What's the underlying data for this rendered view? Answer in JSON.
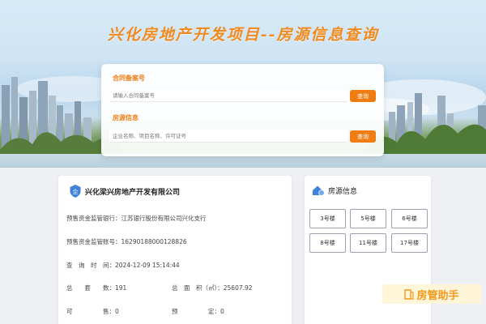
{
  "hero": {
    "title": "兴化房地产开发项目--房源信息查询"
  },
  "search": {
    "contract_label": "合同备案号",
    "contract_placeholder": "请输入合同备案号",
    "contract_button": "查询",
    "housing_label": "房源信息",
    "housing_placeholder": "企业名称、项目名称、许可证号",
    "housing_button": "查询"
  },
  "company": {
    "name": "兴化梁兴房地产开发有限公司",
    "rows": {
      "bank_label": "预售资金监管银行：",
      "bank_value": "江苏银行股份有限公司兴化支行",
      "account_label": "预售资金监管账号：",
      "account_value": "16290188000128826",
      "time_label": "查　询　时　间：",
      "time_value": "2024-12-09 15:14:44",
      "units_label": "总　　套　　数：",
      "units_value": "191",
      "area_label": "总　面　积（㎡）：",
      "area_value": "25607.92",
      "sellable_label": "可　　　　　售：",
      "sellable_value": "0",
      "reserved_label": "预　　　　　定：",
      "reserved_value": "0"
    }
  },
  "housing": {
    "title": "房源信息",
    "buildings": [
      "3号楼",
      "5号楼",
      "6号楼",
      "8号楼",
      "11号楼",
      "17号楼"
    ]
  },
  "watermark": {
    "text": "房管助手"
  },
  "colors": {
    "accent": "#f07d13",
    "title": "#f08a1e"
  }
}
